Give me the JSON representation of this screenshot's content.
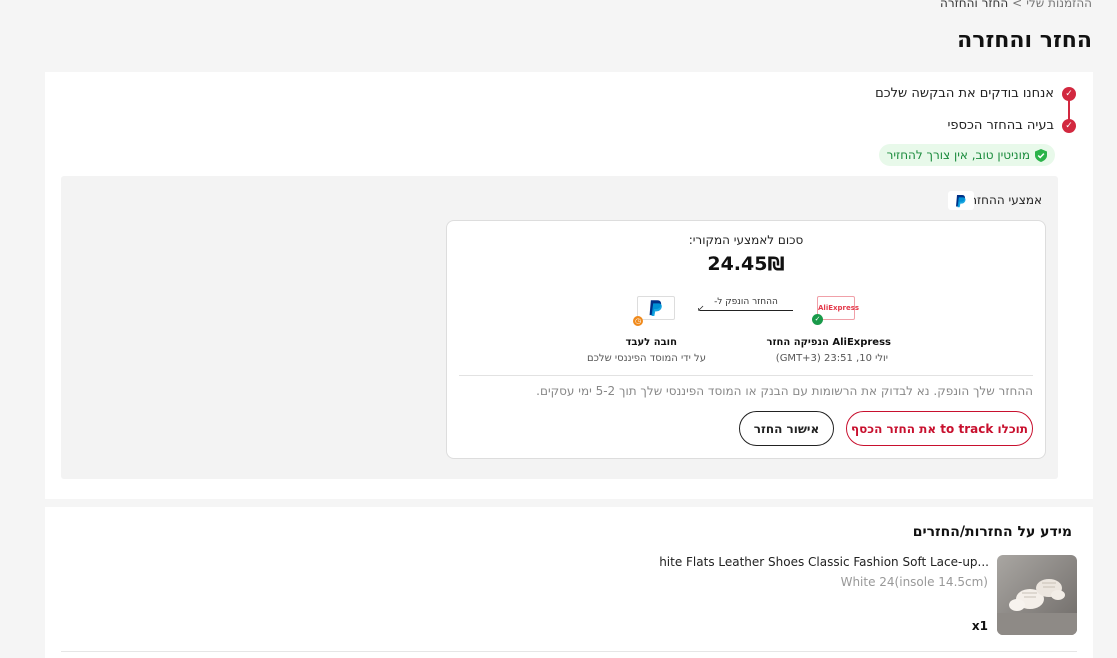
{
  "breadcrumb": {
    "prev": "ההזמנות שלי",
    "separator": ">",
    "current": "החזר והחזרה"
  },
  "page_title": "החזר והחזרה",
  "steps": [
    {
      "text": "אנחנו בודקים את הבקשה שלכם"
    },
    {
      "text": "בעיה בהחזר הכספי"
    }
  ],
  "badge": {
    "text": "מוניטין טוב, אין צורך להחזיר"
  },
  "refund": {
    "method_label": "אמצעי ההחזר:",
    "sum_label": "סכום לאמצעי המקורי:",
    "amount": "24.45₪",
    "flow_label": "ההחזר הונפק ל-",
    "aliexpress_logo": "AliExpress",
    "aliexpress_title": "AliExpress הנפיקה החזר",
    "aliexpress_date": "יולי 10, 23:51 (GMT+3)",
    "paypal_title": "חובה לעבד",
    "paypal_sub": "על ידי המוסד הפיננסי שלכם",
    "info_text": "ההחזר שלך הונפק. נא לבדוק את הרשומות עם הבנק או המוסד הפיננסי שלך תוך 5-2 ימי עסקים.",
    "btn_track": "תוכלו to track את החזר הכסף",
    "btn_confirm": "אישור החזר"
  },
  "info_section": {
    "title": "מידע על החזרות/החזרים",
    "product_name": "hite Flats Leather Shoes Classic Fashion Soft Lace-up...",
    "variant": "White 24(insole 14.5cm)",
    "quantity": "x1"
  },
  "colors": {
    "accent": "#d2283f",
    "success": "#1a8b3c",
    "brand_red": "#e43a4b",
    "paypal_dark": "#003087",
    "paypal_light": "#009cde"
  },
  "icons": [
    "check-icon",
    "shield-check-icon",
    "paypal-icon",
    "aliexpress-logo",
    "clock-icon",
    "arrow-left-icon"
  ]
}
